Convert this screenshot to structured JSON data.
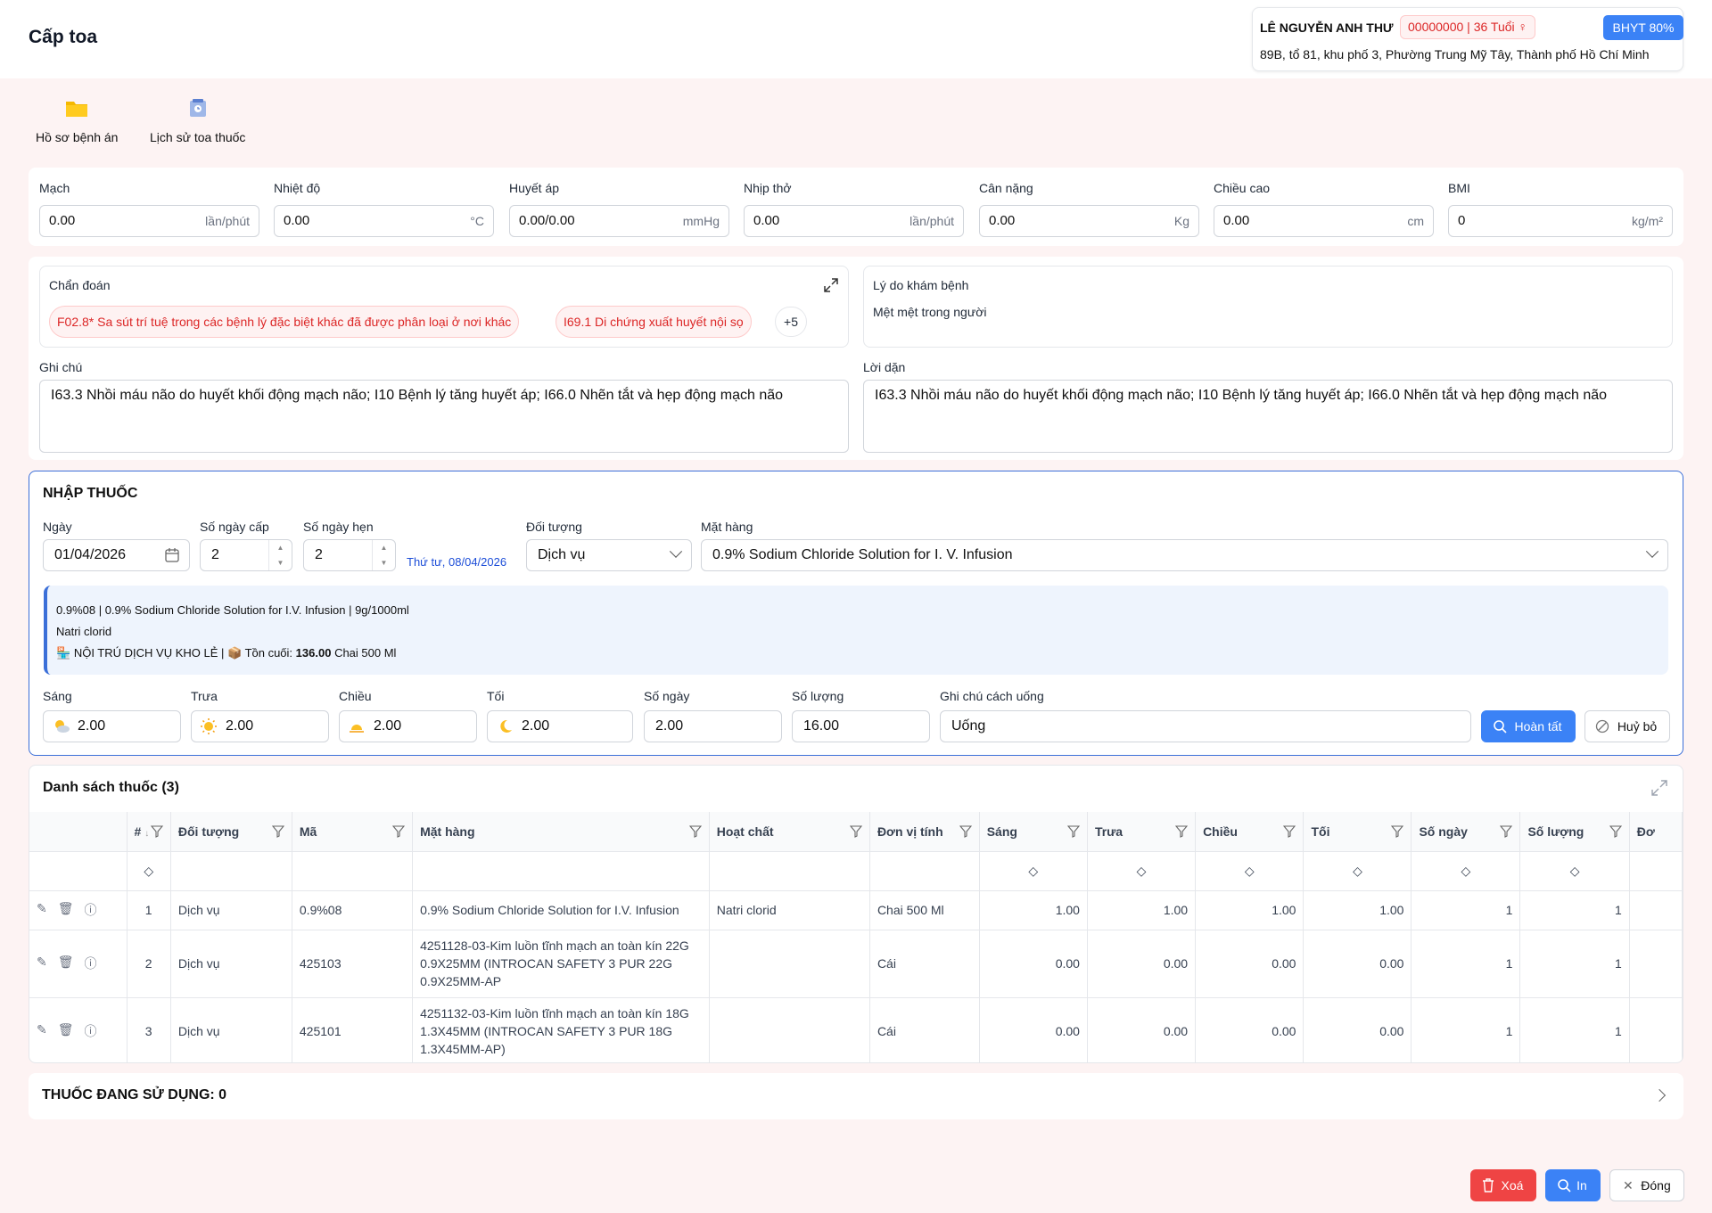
{
  "page": {
    "title": "Cấp toa"
  },
  "patient": {
    "name": "LÊ NGUYỄN ANH THƯ",
    "id_age": "00000000 | 36 Tuổi",
    "insurance": "BHYT 80%",
    "address": "89B, tổ 81, khu phố 3, Phường Trung Mỹ Tây, Thành phố Hồ Chí Minh"
  },
  "toolbar": {
    "records": "Hồ sơ bệnh án",
    "history": "Lịch sử toa thuốc"
  },
  "vitals": [
    {
      "label": "Mạch",
      "value": "0.00",
      "unit": "lần/phút"
    },
    {
      "label": "Nhiệt độ",
      "value": "0.00",
      "unit": "°C"
    },
    {
      "label": "Huyết áp",
      "value": "0.00/0.00",
      "unit": "mmHg"
    },
    {
      "label": "Nhịp thở",
      "value": "0.00",
      "unit": "lần/phút"
    },
    {
      "label": "Cân nặng",
      "value": "0.00",
      "unit": "Kg"
    },
    {
      "label": "Chiều cao",
      "value": "0.00",
      "unit": "cm"
    },
    {
      "label": "BMI",
      "value": "0",
      "unit": "kg/m²"
    }
  ],
  "diagnosis": {
    "label": "Chẩn đoán",
    "tags": [
      "F02.8* Sa sút trí tuệ trong các bệnh lý đặc biệt khác đã được phân loại ở nơi khác",
      "I69.1 Di chứng xuất huyết nội sọ"
    ],
    "more": "+5"
  },
  "reason": {
    "label": "Lý do khám bệnh",
    "value": "Mệt mệt trong người"
  },
  "note": {
    "label": "Ghi chú",
    "value": "I63.3 Nhồi máu não do huyết khối động mạch não; I10 Bệnh lý tăng huyết áp; I66.0 Nhẽn tắt và hẹp động mạch não"
  },
  "advice": {
    "label": "Lời dặn",
    "value": "I63.3 Nhồi máu não do huyết khối động mạch não; I10 Bệnh lý tăng huyết áp; I66.0 Nhẽn tắt và hẹp động mạch não"
  },
  "entry": {
    "heading": "NHẬP THUỐC",
    "date_label": "Ngày",
    "date": "01/04/2026",
    "days_label": "Số ngày cấp",
    "days": "2",
    "appt_label": "Số ngày hẹn",
    "appt": "2",
    "appt_date": "Thứ tư, 08/04/2026",
    "object_label": "Đối tượng",
    "object": "Dịch vụ",
    "item_label": "Mặt hàng",
    "item": "0.9% Sodium Chloride Solution for I. V. Infusion",
    "info_line1": "0.9%08 | 0.9% Sodium Chloride Solution for I.V. Infusion | 9g/1000ml",
    "info_line2": "Natri clorid",
    "info_store": "NỘI TRÚ DỊCH VỤ KHO LẺ",
    "info_stock_label": "Tồn cuối:",
    "info_stock_value": "136.00",
    "info_stock_unit": "Chai 500 Ml",
    "morning_label": "Sáng",
    "morning": "2.00",
    "noon_label": "Trưa",
    "noon": "2.00",
    "afternoon_label": "Chiều",
    "afternoon": "2.00",
    "night_label": "Tối",
    "night": "2.00",
    "ndays_label": "Số ngày",
    "ndays": "2.00",
    "qty_label": "Số lượng",
    "qty": "16.00",
    "usage_label": "Ghi chú cách uống",
    "usage": "Uống",
    "done": "Hoàn tất",
    "cancel": "Huỷ bỏ"
  },
  "list": {
    "title": "Danh sách thuốc (3)",
    "columns": [
      "#",
      "Đối tượng",
      "Mã",
      "Mặt hàng",
      "Hoạt chất",
      "Đơn vị tính",
      "Sáng",
      "Trưa",
      "Chiều",
      "Tối",
      "Số ngày",
      "Số lượng",
      "Đơ"
    ],
    "rows": [
      {
        "no": "1",
        "object": "Dịch vụ",
        "code": "0.9%08",
        "item": "0.9% Sodium Chloride Solution for I.V. Infusion",
        "active": "Natri clorid",
        "unit": "Chai 500 Ml",
        "morning": "1.00",
        "noon": "1.00",
        "afternoon": "1.00",
        "night": "1.00",
        "days": "1",
        "qty": "1"
      },
      {
        "no": "2",
        "object": "Dịch vụ",
        "code": "425103",
        "item": "4251128-03-Kim luồn tĩnh mạch an toàn kín 22G 0.9X25MM (INTROCAN SAFETY 3 PUR 22G 0.9X25MM-AP",
        "active": "",
        "unit": "Cái",
        "morning": "0.00",
        "noon": "0.00",
        "afternoon": "0.00",
        "night": "0.00",
        "days": "1",
        "qty": "1"
      },
      {
        "no": "3",
        "object": "Dịch vụ",
        "code": "425101",
        "item": "4251132-03-Kim luồn tĩnh mạch an toàn kín 18G 1.3X45MM (INTROCAN SAFETY 3 PUR 18G 1.3X45MM-AP)",
        "active": "",
        "unit": "Cái",
        "morning": "0.00",
        "noon": "0.00",
        "afternoon": "0.00",
        "night": "0.00",
        "days": "1",
        "qty": "1"
      }
    ]
  },
  "in_use": {
    "label": "THUỐC ĐANG SỬ DỤNG: 0"
  },
  "footer": {
    "delete": "Xoá",
    "print": "In",
    "close": "Đóng"
  }
}
